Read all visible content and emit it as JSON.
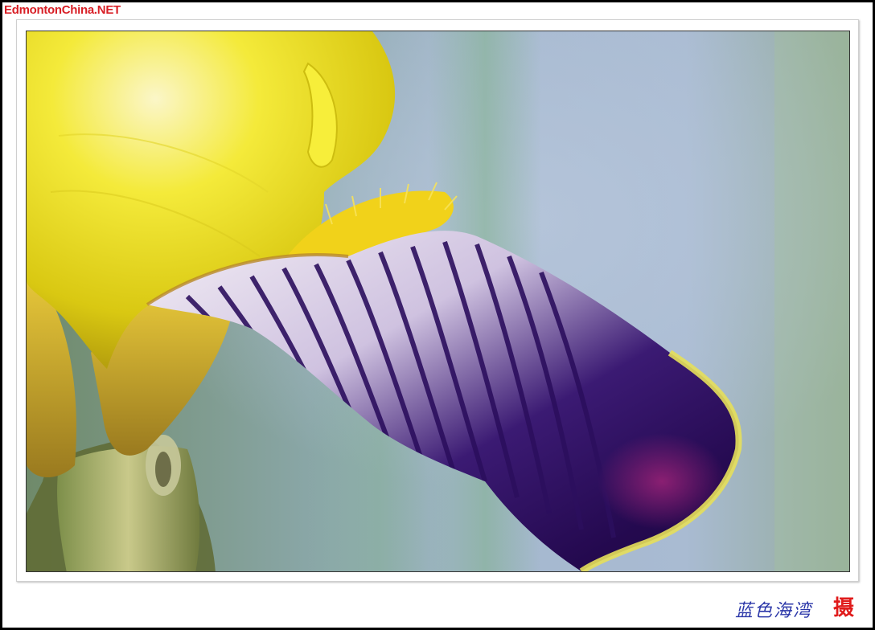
{
  "watermark": {
    "text": "EdmontonChina.NET",
    "color": "#d81f26"
  },
  "photo": {
    "subject": "iris-flower-closeup",
    "colors": {
      "background_blue": "#9fb3c8",
      "petal_yellow": "#f2e31c",
      "falls_purple": "#2a0f5a",
      "falls_magenta": "#7a1a6a"
    }
  },
  "signature": {
    "text": "蓝色海湾",
    "color": "#2a36a8"
  },
  "seal": {
    "text": "摄",
    "color": "#e01b1b"
  }
}
